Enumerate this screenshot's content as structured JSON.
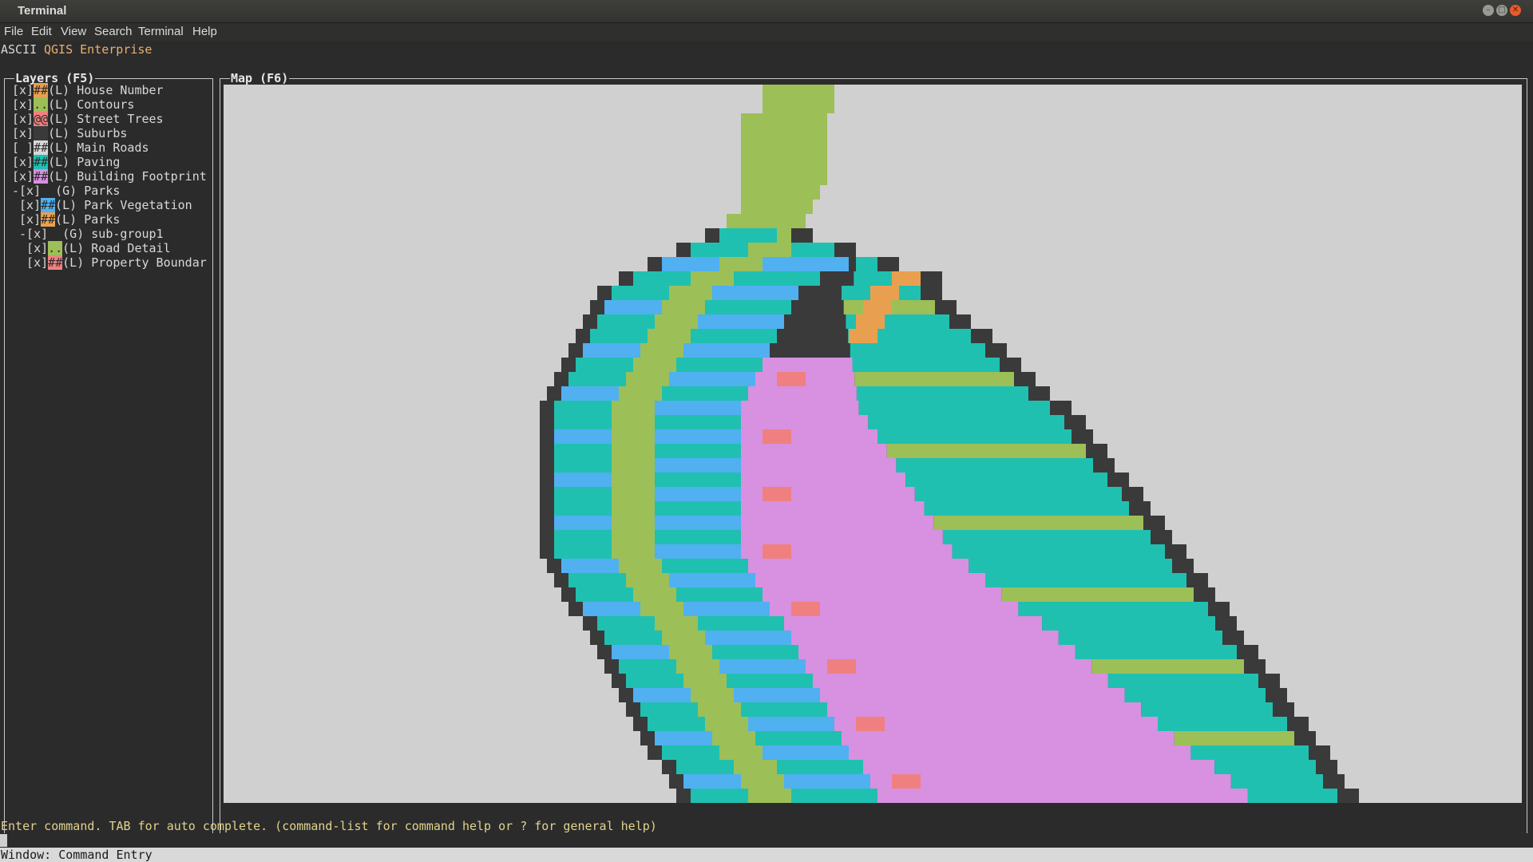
{
  "window": {
    "title": "Terminal",
    "controls": [
      "minimize",
      "maximize",
      "close"
    ]
  },
  "menu": [
    "File",
    "Edit",
    "View",
    "Search",
    "Terminal",
    "Help"
  ],
  "app": {
    "title_prefix": "ASCII",
    "title_rest": "QGIS Enterprise"
  },
  "layers_panel": {
    "title": "Layers (F5)",
    "rows": [
      {
        "prefix": "[x]",
        "symbol": "##",
        "color": "#e8a050",
        "label": "(L) House Number"
      },
      {
        "prefix": "[x]",
        "symbol": "..",
        "color": "#9cbf58",
        "label": "(L) Contours"
      },
      {
        "prefix": "[x]",
        "symbol": "@@",
        "color": "#f08080",
        "label": "(L) Street Trees"
      },
      {
        "prefix": "[x]",
        "symbol": "  ",
        "color": "#3a3a3a",
        "label": "(L) Suburbs"
      },
      {
        "prefix": "[ ]",
        "symbol": "##",
        "color": "#d8d8d8",
        "label": "(L) Main Roads"
      },
      {
        "prefix": "[x]",
        "symbol": "##",
        "color": "#20c0b0",
        "label": "(L) Paving"
      },
      {
        "prefix": "[x]",
        "symbol": "##",
        "color": "#d890e0",
        "label": "(L) Building Footprint"
      },
      {
        "prefix": "-[x]",
        "symbol": "  ",
        "color": "",
        "label": "(G) Parks"
      },
      {
        "prefix": " [x]",
        "symbol": "##",
        "color": "#50b0f0",
        "label": "(L) Park Vegetation"
      },
      {
        "prefix": " [x]",
        "symbol": "##",
        "color": "#e8a050",
        "label": "(L) Parks"
      },
      {
        "prefix": " -[x]",
        "symbol": "  ",
        "color": "",
        "label": "(G) sub-group1"
      },
      {
        "prefix": "  [x]",
        "symbol": "..",
        "color": "#9cbf58",
        "label": "(L) Road Detail"
      },
      {
        "prefix": "  [x]",
        "symbol": "##",
        "color": "#f08080",
        "label": "(L) Property Boundar"
      }
    ]
  },
  "map_panel": {
    "title": "Map (F6)",
    "background": "#d0d0d0",
    "palette": {
      "suburb_dark": "#3a3a3a",
      "contour_green": "#9cbf58",
      "paving_teal": "#20c0b0",
      "park_blue": "#50b0f0",
      "building_pink": "#d890e0",
      "boundary_red": "#f08080",
      "house_orange": "#e8a050"
    }
  },
  "command": {
    "hint": "Enter command. TAB for auto complete. (command-list for command help or ? for general help)",
    "value": ""
  },
  "status": {
    "text": "Window: Command Entry"
  }
}
